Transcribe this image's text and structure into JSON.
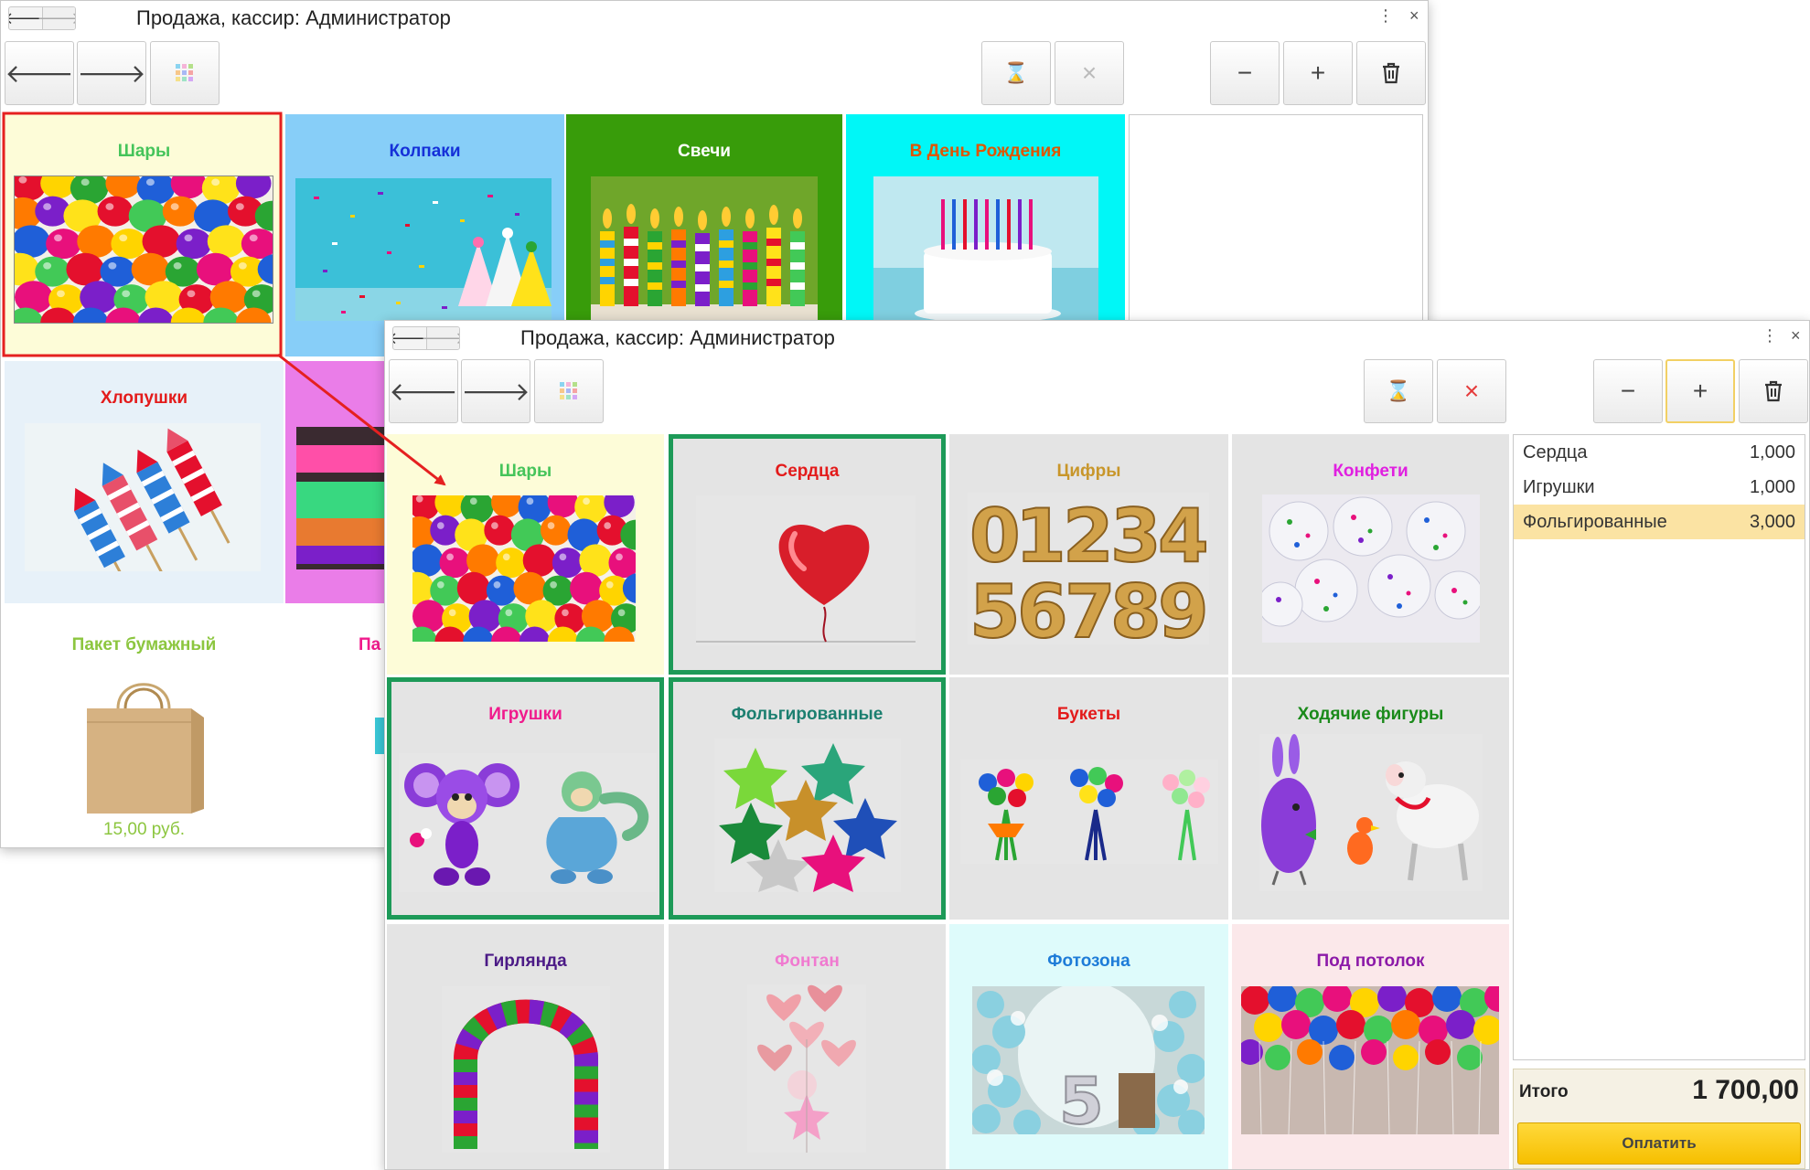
{
  "back_window": {
    "title": "Продажа, кассир: Администратор",
    "tiles": [
      {
        "name": "Шары",
        "color": "#45c45a"
      },
      {
        "name": "Колпаки",
        "color": "#1530d8"
      },
      {
        "name": "Свечи",
        "color": "#ffffff"
      },
      {
        "name": "В День Рождения",
        "color": "#e05500"
      },
      {
        "name": "Хлопушки",
        "color": "#e31b1b"
      },
      {
        "name": "Пакет бумажный",
        "color": "#8cc63f",
        "price": "15,00 руб."
      }
    ]
  },
  "front_window": {
    "title": "Продажа, кассир: Администратор",
    "tiles": [
      {
        "name": "Шары",
        "color": "#45c45a"
      },
      {
        "name": "Сердца",
        "color": "#e31b1b"
      },
      {
        "name": "Цифры",
        "color": "#c8962a"
      },
      {
        "name": "Конфети",
        "color": "#e020e0"
      },
      {
        "name": "Игрушки",
        "color": "#f01a8c"
      },
      {
        "name": "Фольгированные",
        "color": "#1c7f70"
      },
      {
        "name": "Букеты",
        "color": "#e31b1b"
      },
      {
        "name": "Ходячие фигуры",
        "color": "#1a8a1a"
      },
      {
        "name": "Гирлянда",
        "color": "#4b1a86"
      },
      {
        "name": "Фонтан",
        "color": "#f07ad0"
      },
      {
        "name": "Фотозона",
        "color": "#1e7cd8"
      },
      {
        "name": "Под потолок",
        "color": "#8c1aa8"
      }
    ],
    "order": [
      {
        "name": "Сердца",
        "qty": "1,000"
      },
      {
        "name": "Игрушки",
        "qty": "1,000"
      },
      {
        "name": "Фольгированные",
        "qty": "3,000"
      }
    ],
    "total_label": "Итого",
    "total_value": "1 700,00",
    "pay_label": "Оплатить"
  },
  "icons": {
    "back": "arrow-left-icon",
    "forward": "arrow-right-icon",
    "grid": "grid-icon",
    "hourglass": "hourglass-icon",
    "close": "close-icon",
    "minus": "minus-icon",
    "plus": "plus-icon",
    "trash": "trash-icon",
    "more": "more-vertical-icon"
  },
  "colors": {
    "selection_border": "#1d9a58",
    "pay_button": "#f6bf00",
    "current_row": "#fbe3a3",
    "annotation": "#e52020"
  }
}
